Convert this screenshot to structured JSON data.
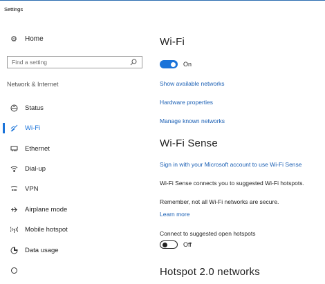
{
  "window": {
    "title": "Settings"
  },
  "sidebar": {
    "home_label": "Home",
    "search_placeholder": "Find a setting",
    "section_label": "Network & Internet",
    "items": [
      {
        "label": "Status",
        "icon": "status-icon"
      },
      {
        "label": "Wi-Fi",
        "icon": "wifi-icon",
        "active": true
      },
      {
        "label": "Ethernet",
        "icon": "ethernet-icon"
      },
      {
        "label": "Dial-up",
        "icon": "dialup-icon"
      },
      {
        "label": "VPN",
        "icon": "vpn-icon"
      },
      {
        "label": "Airplane mode",
        "icon": "airplane-icon"
      },
      {
        "label": "Mobile hotspot",
        "icon": "hotspot-icon"
      },
      {
        "label": "Data usage",
        "icon": "data-usage-icon"
      },
      {
        "label": "",
        "icon": "proxy-icon"
      }
    ]
  },
  "main": {
    "wifi_heading": "Wi-Fi",
    "wifi_toggle_label": "On",
    "wifi_toggle_on": true,
    "links": {
      "show_networks": "Show available networks",
      "hardware": "Hardware properties",
      "manage": "Manage known networks"
    },
    "sense_heading": "Wi-Fi Sense",
    "sense_signin_link": "Sign in with your Microsoft account to use Wi-Fi Sense",
    "sense_desc": "Wi-Fi Sense connects you to suggested Wi-Fi hotspots.",
    "sense_warning": "Remember, not all Wi-Fi networks are secure.",
    "learn_more": "Learn more",
    "connect_label": "Connect to suggested open hotspots",
    "connect_toggle_label": "Off",
    "connect_toggle_on": false,
    "hotspot_heading": "Hotspot 2.0 networks"
  },
  "colors": {
    "accent": "#1a73d9",
    "link": "#1a5fb4"
  }
}
